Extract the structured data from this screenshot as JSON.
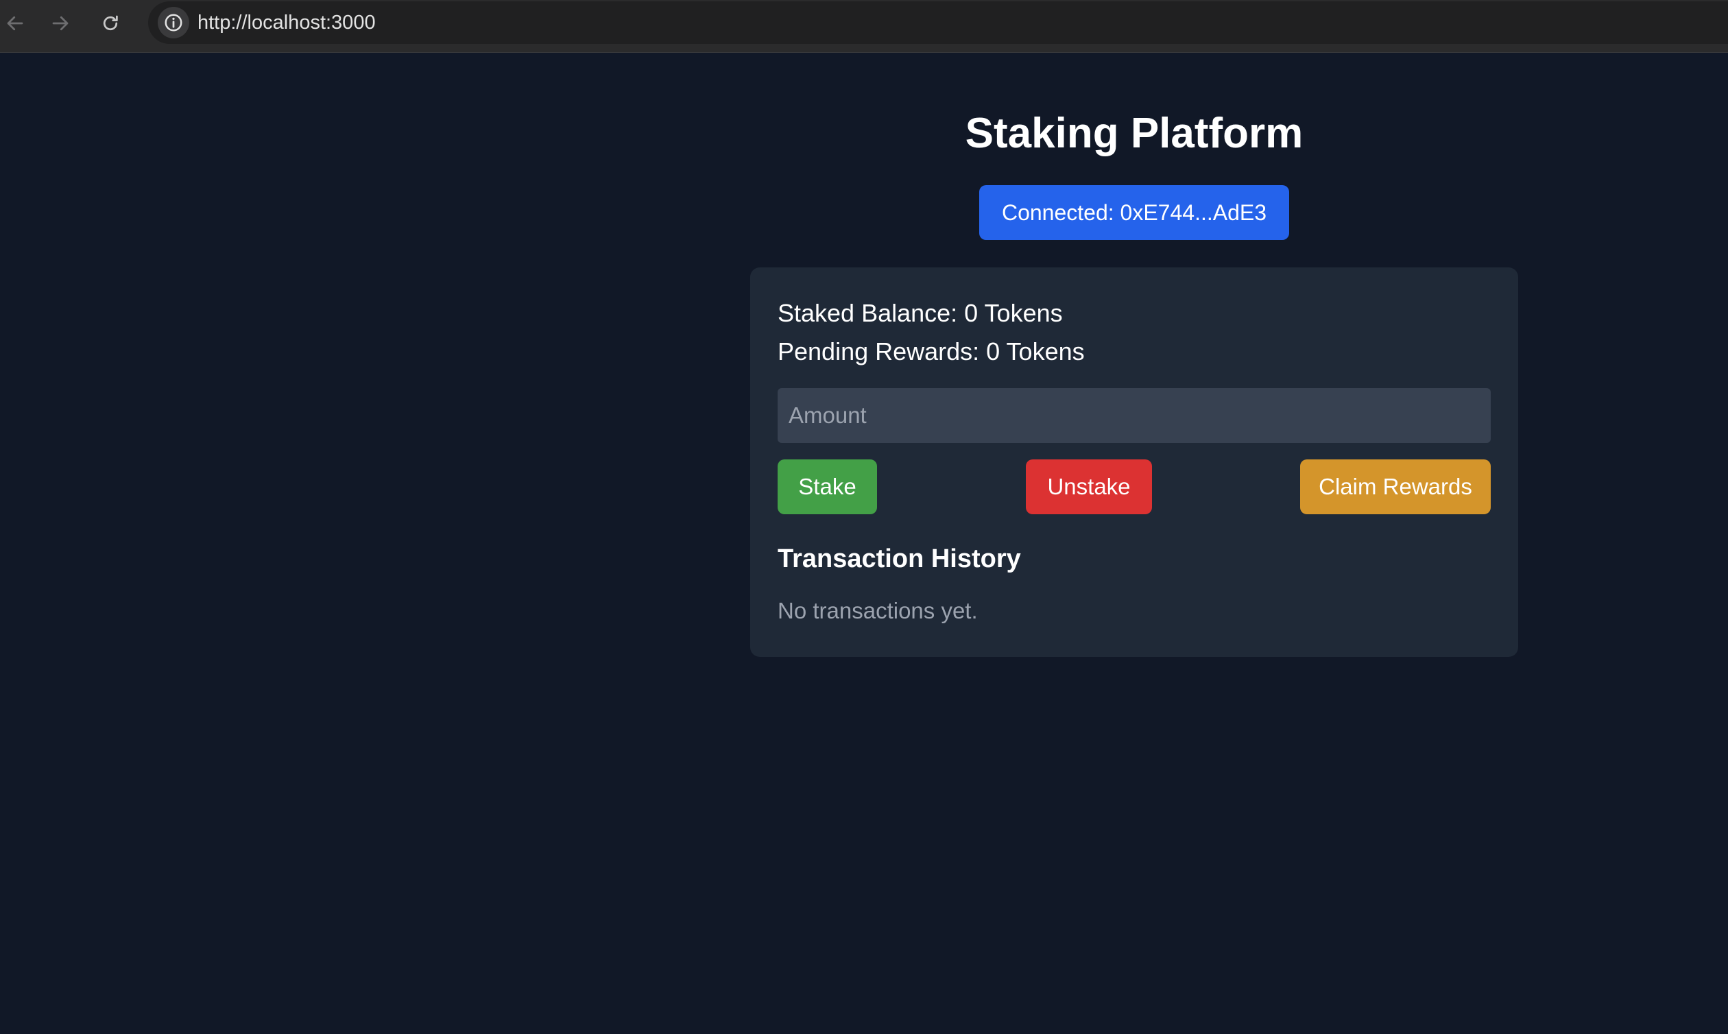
{
  "browser": {
    "url": "http://localhost:3000",
    "icons": {
      "back": "arrow-left-icon",
      "forward": "arrow-right-icon",
      "reload": "reload-icon",
      "site_info": "info-icon"
    }
  },
  "app": {
    "title": "Staking Platform",
    "wallet_button_label": "Connected: 0xE744...AdE3"
  },
  "card": {
    "staked_balance": "Staked Balance: 0 Tokens",
    "pending_rewards": "Pending Rewards: 0 Tokens",
    "amount_input": {
      "value": "",
      "placeholder": "Amount"
    },
    "actions": {
      "stake_label": "Stake",
      "unstake_label": "Unstake",
      "claim_label": "Claim Rewards"
    },
    "history": {
      "title": "Transaction History",
      "empty_text": "No transactions yet."
    }
  },
  "colors": {
    "background": "#111827",
    "card": "#1f2937",
    "input": "#374151",
    "wallet_button": "#2563eb",
    "stake_button": "#43a047",
    "unstake_button": "#dc3232",
    "claim_button": "#d4952b"
  }
}
